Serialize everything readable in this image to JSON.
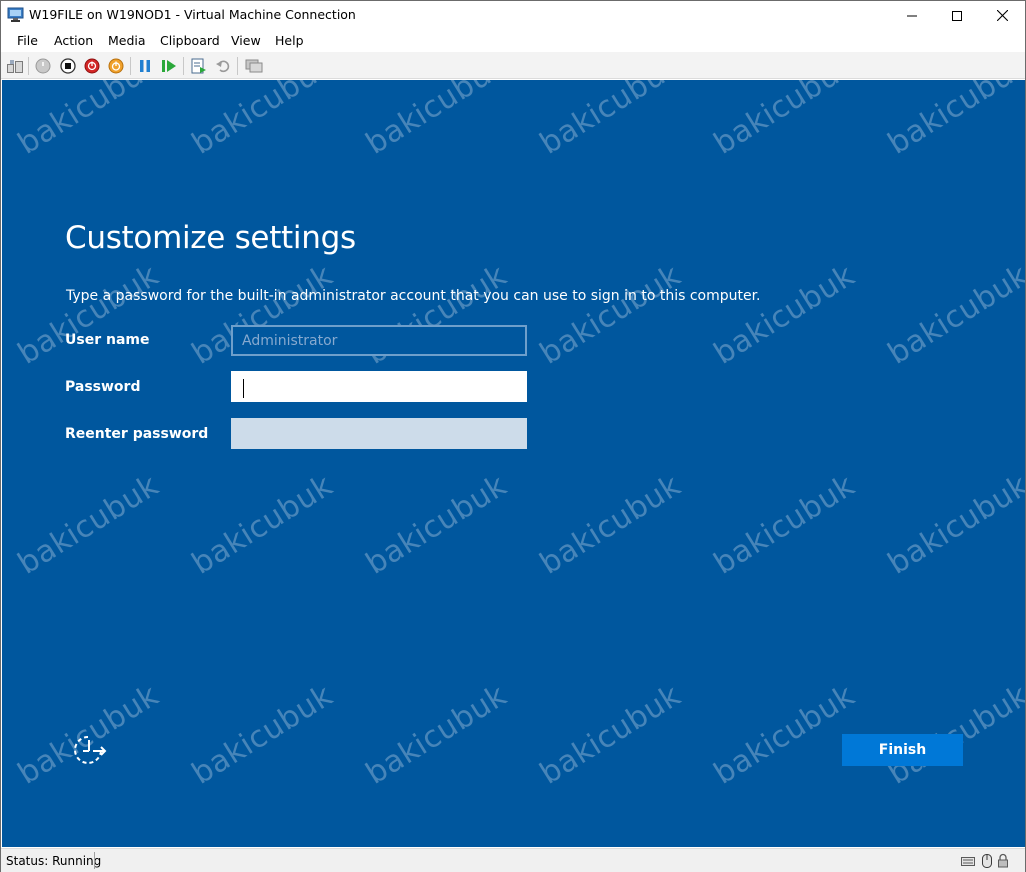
{
  "window": {
    "title": "W19FILE on W19NOD1 - Virtual Machine Connection"
  },
  "menu": {
    "items": [
      "File",
      "Action",
      "Media",
      "Clipboard",
      "View",
      "Help"
    ]
  },
  "toolbar": {
    "icons": [
      "ctrl-alt-del-icon",
      "start-icon",
      "turn-off-icon",
      "shutdown-icon",
      "save-icon",
      "pause-icon",
      "resume-icon",
      "checkpoint-icon",
      "revert-icon",
      "enhanced-session-icon"
    ]
  },
  "setup": {
    "heading": "Customize settings",
    "description": "Type a password for the built-in administrator account that you can use to sign in to this computer.",
    "username_label": "User name",
    "username_value": "Administrator",
    "password_label": "Password",
    "reenter_label": "Reenter password",
    "finish_label": "Finish"
  },
  "watermark": {
    "text": "bakicubuk"
  },
  "status": {
    "text": "Status: Running"
  },
  "colors": {
    "screen_bg": "#00579e",
    "finish_btn": "#0078d7"
  }
}
